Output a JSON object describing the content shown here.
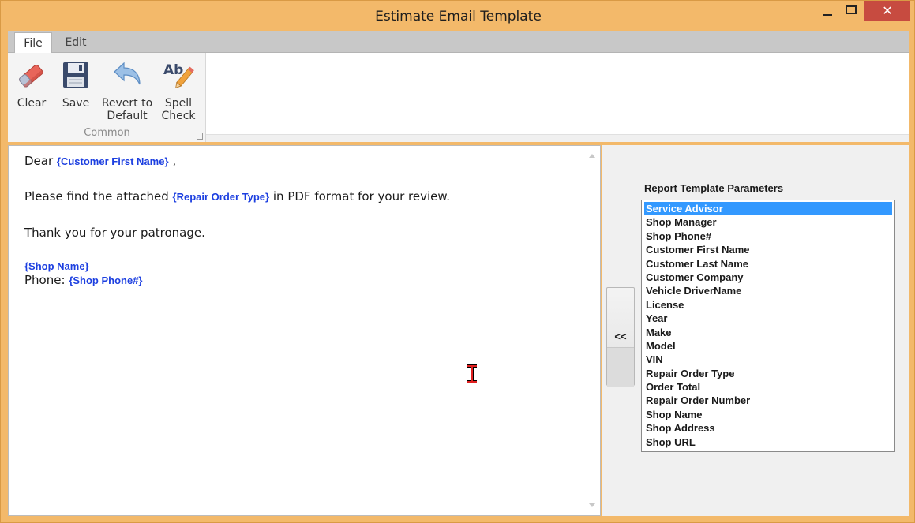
{
  "window": {
    "title": "Estimate Email Template",
    "close_glyph": "✕"
  },
  "ribbon": {
    "tabs": [
      {
        "label": "File",
        "active": true
      },
      {
        "label": "Edit",
        "active": false
      }
    ],
    "group_label": "Common",
    "buttons": [
      {
        "label": "Clear",
        "icon": "eraser-icon"
      },
      {
        "label": "Save",
        "icon": "floppy-disk-icon"
      },
      {
        "label": "Revert to\nDefault",
        "icon": "undo-arrow-icon"
      },
      {
        "label": "Spell\nCheck",
        "icon": "spell-check-icon"
      }
    ]
  },
  "editor": {
    "line1_prefix": "Dear",
    "line1_field": "{Customer First Name}",
    "line1_suffix": ",",
    "line2_prefix": "Please find the attached",
    "line2_field": "{Repair Order Type}",
    "line2_suffix": "in PDF format for your review.",
    "line3": "Thank you for your patronage.",
    "line4_field": "{Shop Name}",
    "line5_prefix": "Phone:",
    "line5_field": "{Shop Phone#}"
  },
  "params_panel": {
    "insert_button_label": "<<",
    "label": "Report Template Parameters",
    "selected_index": 0,
    "items": [
      "Service Advisor",
      "Shop Manager",
      "Shop Phone#",
      "Customer First Name",
      "Customer Last Name",
      "Customer Company",
      "Vehicle DriverName",
      "License",
      "Year",
      "Make",
      "Model",
      "VIN",
      "Repair Order Type",
      "Order Total",
      "Repair Order Number",
      "Shop Name",
      "Shop Address",
      "Shop URL"
    ]
  },
  "colors": {
    "frame": "#f3b96a",
    "field_text": "#1c3fe0",
    "selection": "#3399ff",
    "close_button": "#c74b40"
  }
}
